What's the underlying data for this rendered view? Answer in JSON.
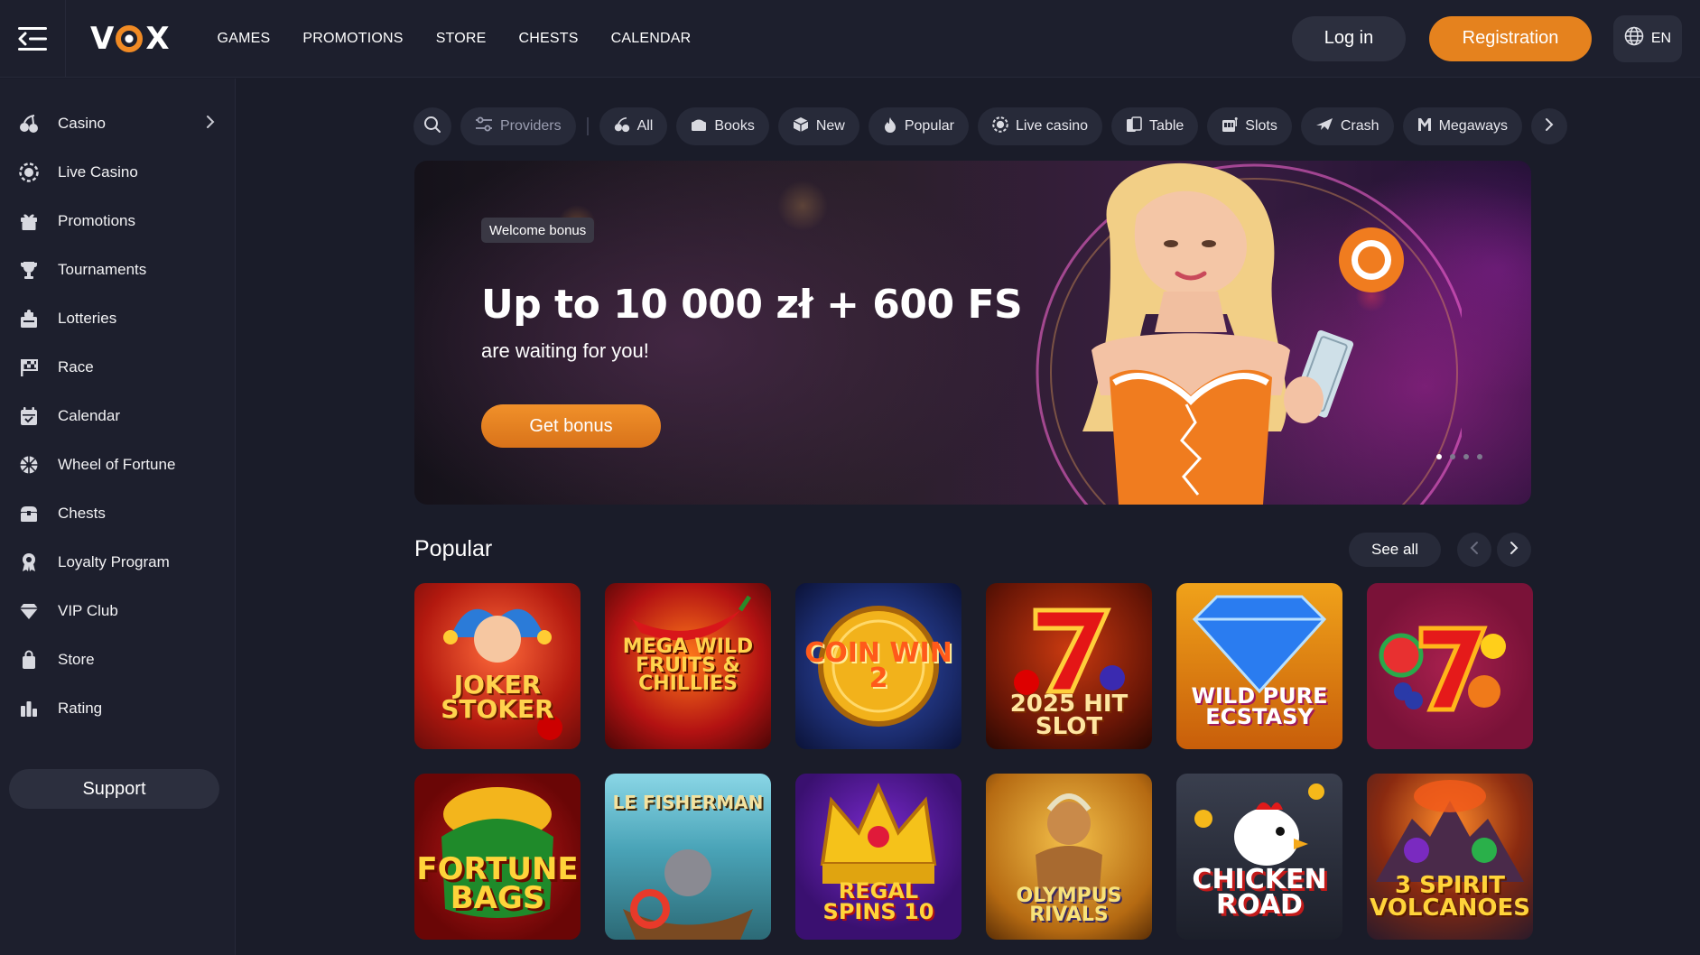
{
  "header": {
    "logo_text_left": "V",
    "logo_text_right": "X",
    "nav": [
      "GAMES",
      "PROMOTIONS",
      "STORE",
      "CHESTS",
      "CALENDAR"
    ],
    "login_label": "Log in",
    "register_label": "Registration",
    "lang_label": "EN"
  },
  "colors": {
    "accent": "#e5821e",
    "background": "#1a1c29",
    "panel": "#1d1f2d",
    "chip": "#272a39"
  },
  "sidebar": {
    "items": [
      {
        "label": "Casino",
        "icon": "cherries-icon"
      },
      {
        "label": "Live Casino",
        "icon": "live-chip-icon"
      },
      {
        "label": "Promotions",
        "icon": "gift-icon"
      },
      {
        "label": "Tournaments",
        "icon": "trophy-icon"
      },
      {
        "label": "Lotteries",
        "icon": "lottery-icon"
      },
      {
        "label": "Race",
        "icon": "race-flag-icon"
      },
      {
        "label": "Calendar",
        "icon": "calendar-icon"
      },
      {
        "label": "Wheel of Fortune",
        "icon": "wheel-icon"
      },
      {
        "label": "Chests",
        "icon": "chest-icon"
      },
      {
        "label": "Loyalty Program",
        "icon": "loyalty-badge-icon"
      },
      {
        "label": "VIP Club",
        "icon": "diamond-icon"
      },
      {
        "label": "Store",
        "icon": "shopping-bag-icon"
      },
      {
        "label": "Rating",
        "icon": "bar-chart-icon"
      }
    ],
    "support_label": "Support"
  },
  "filters": {
    "providers_label": "Providers",
    "categories": [
      {
        "label": "All",
        "icon": "cherries-icon"
      },
      {
        "label": "Books",
        "icon": "book-icon"
      },
      {
        "label": "New",
        "icon": "cube-icon"
      },
      {
        "label": "Popular",
        "icon": "flame-icon"
      },
      {
        "label": "Live casino",
        "icon": "live-chip-icon"
      },
      {
        "label": "Table",
        "icon": "cards-icon"
      },
      {
        "label": "Slots",
        "icon": "slot-machine-icon"
      },
      {
        "label": "Crash",
        "icon": "plane-icon"
      },
      {
        "label": "Megaways",
        "icon": "megaways-m-icon"
      }
    ]
  },
  "banner": {
    "badge": "Welcome bonus",
    "title": "Up to 10 000 zł + 600 FS",
    "subtitle": "are waiting for you!",
    "button_label": "Get bonus",
    "slide_count": 4,
    "active_slide": 1
  },
  "popular": {
    "title": "Popular",
    "see_all_label": "See all",
    "games": [
      {
        "title": "Joker Stoker"
      },
      {
        "title": "Mega Wild Fruits & Chillies"
      },
      {
        "title": "Coin Win 2"
      },
      {
        "title": "2025 Hit Slot"
      },
      {
        "title": "Wild Pure Ecstasy"
      },
      {
        "title": ""
      },
      {
        "title": "Fortune Bags"
      },
      {
        "title": "Le Fisherman"
      },
      {
        "title": "Regal Spins 10"
      },
      {
        "title": "Olympus Rivals"
      },
      {
        "title": "Chicken Road"
      },
      {
        "title": "3 Spirit Volcanoes"
      }
    ]
  }
}
